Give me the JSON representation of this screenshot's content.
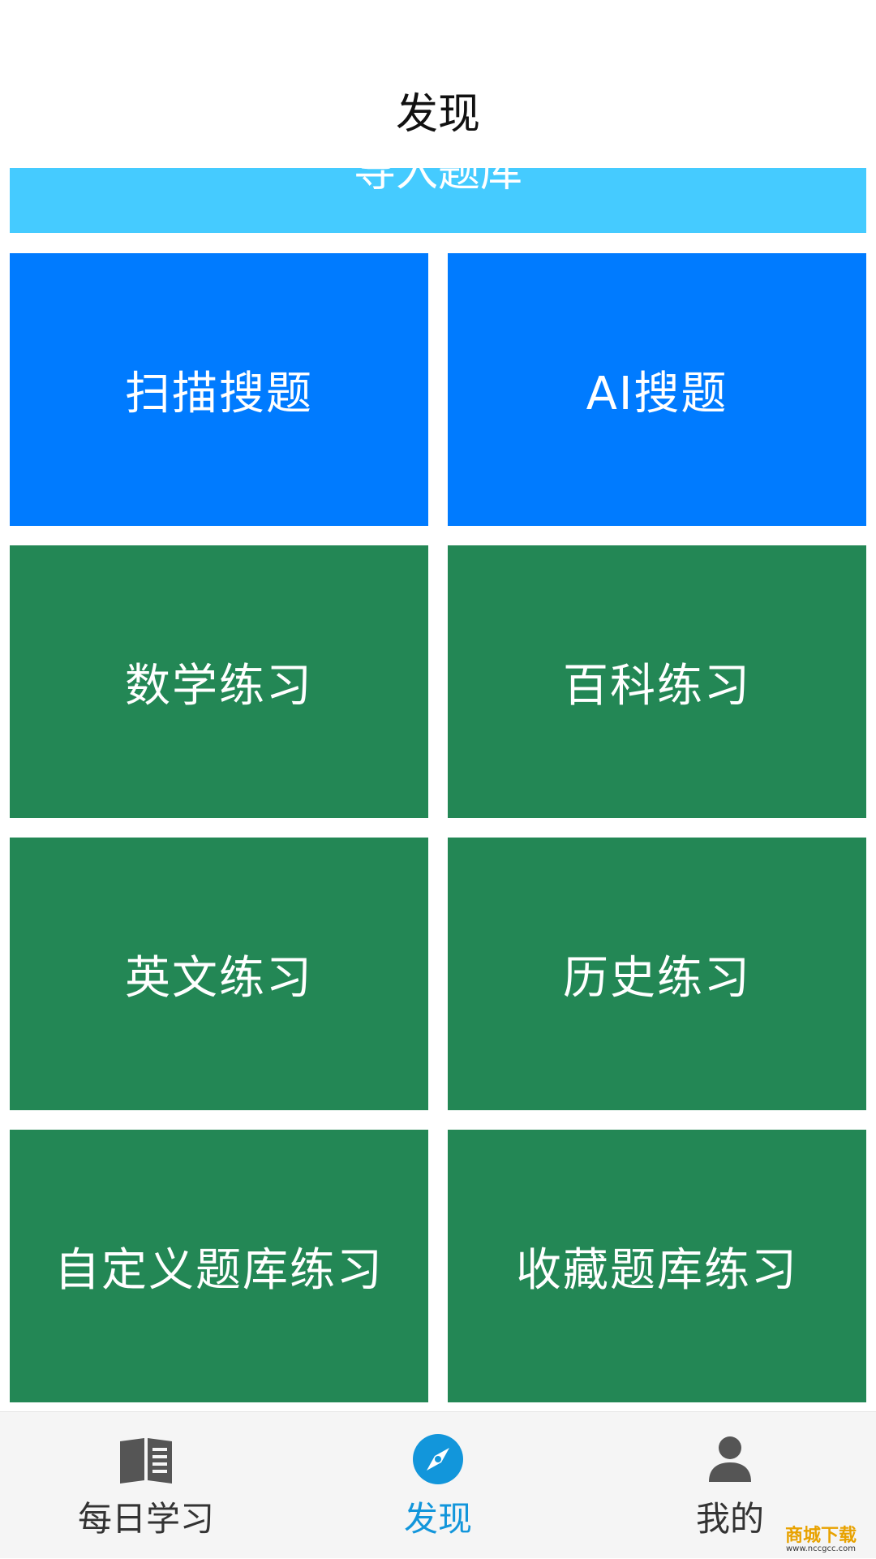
{
  "header": {
    "title": "发现"
  },
  "banner": {
    "label": "导入题库"
  },
  "tiles": [
    {
      "label": "扫描搜题",
      "color": "#007BFF"
    },
    {
      "label": "AI搜题",
      "color": "#007BFF"
    },
    {
      "label": "数学练习",
      "color": "#238755"
    },
    {
      "label": "百科练习",
      "color": "#238755"
    },
    {
      "label": "英文练习",
      "color": "#238755"
    },
    {
      "label": "历史练习",
      "color": "#238755"
    },
    {
      "label": "自定义题库练习",
      "color": "#238755"
    },
    {
      "label": "收藏题库练习",
      "color": "#238755"
    }
  ],
  "nav": {
    "items": [
      {
        "label": "每日学习",
        "icon": "book-icon",
        "active": false
      },
      {
        "label": "发现",
        "icon": "compass-icon",
        "active": true
      },
      {
        "label": "我的",
        "icon": "person-icon",
        "active": false
      }
    ]
  },
  "colors": {
    "banner": "#45CBFF",
    "primary_blue": "#007BFF",
    "green": "#238755",
    "nav_active": "#1296DB",
    "nav_inactive": "#555555"
  },
  "watermark": {
    "logo": "商城下载",
    "url": "www.nccgcc.com"
  }
}
